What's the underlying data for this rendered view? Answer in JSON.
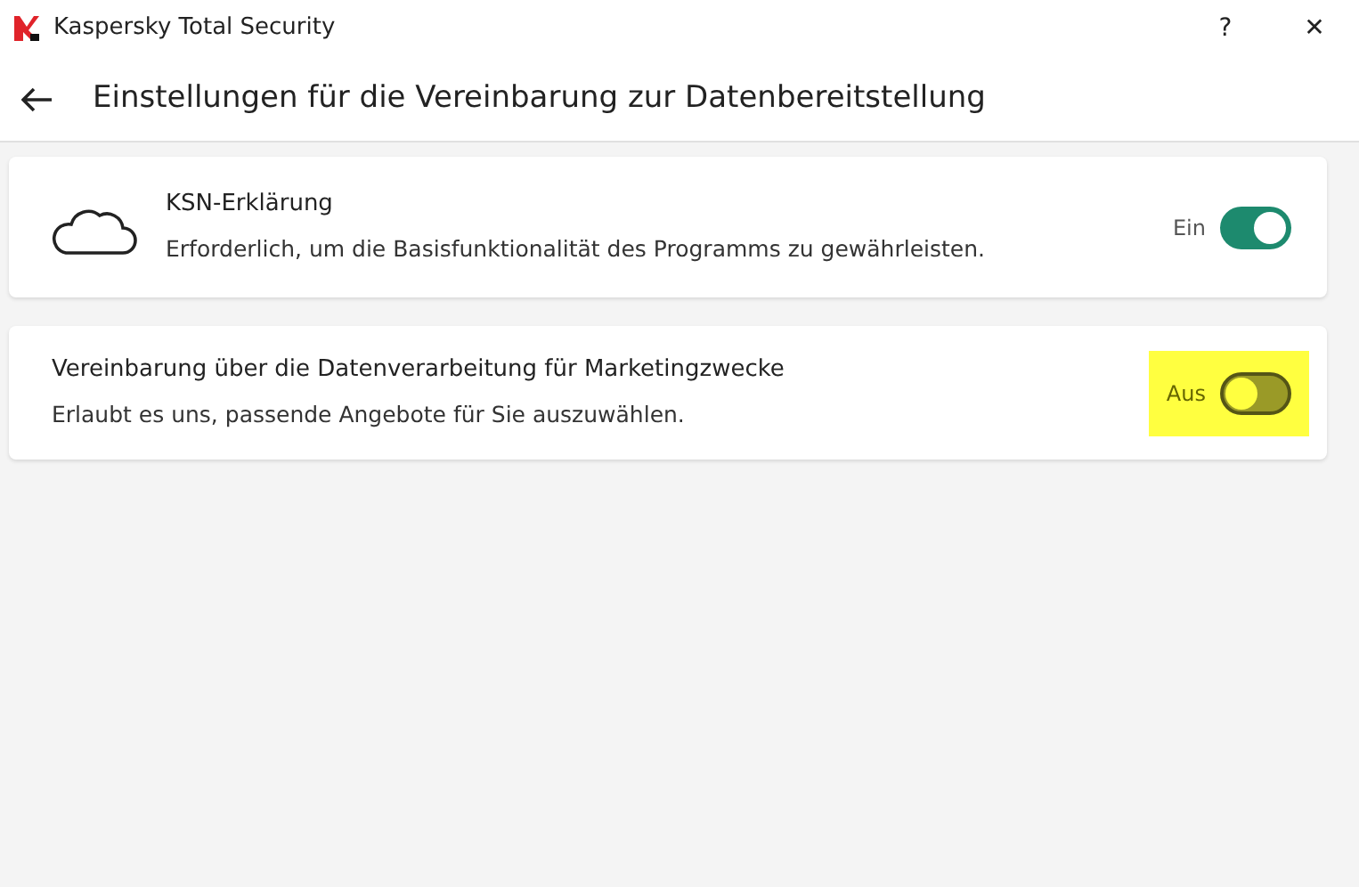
{
  "window": {
    "title": "Kaspersky Total Security",
    "controls": [
      "?",
      "✕"
    ]
  },
  "header": {
    "title": "Einstellungen für die Vereinbarung zur Datenbereitstellung"
  },
  "cards": [
    {
      "kind": "with_icon",
      "title": "KSN-Erklärung",
      "description": "Erforderlich, um die Basisfunktionalität des Programms zu gewährleisten.",
      "toggle_label": "Ein",
      "on": true,
      "highlighted": false
    },
    {
      "kind": "plain",
      "title": "Vereinbarung über die Datenverarbeitung für Marketingzwecke",
      "description": "Erlaubt es uns, passende Angebote für Sie auszuwählen.",
      "toggle_label": "Aus",
      "on": false,
      "highlighted": true
    }
  ]
}
